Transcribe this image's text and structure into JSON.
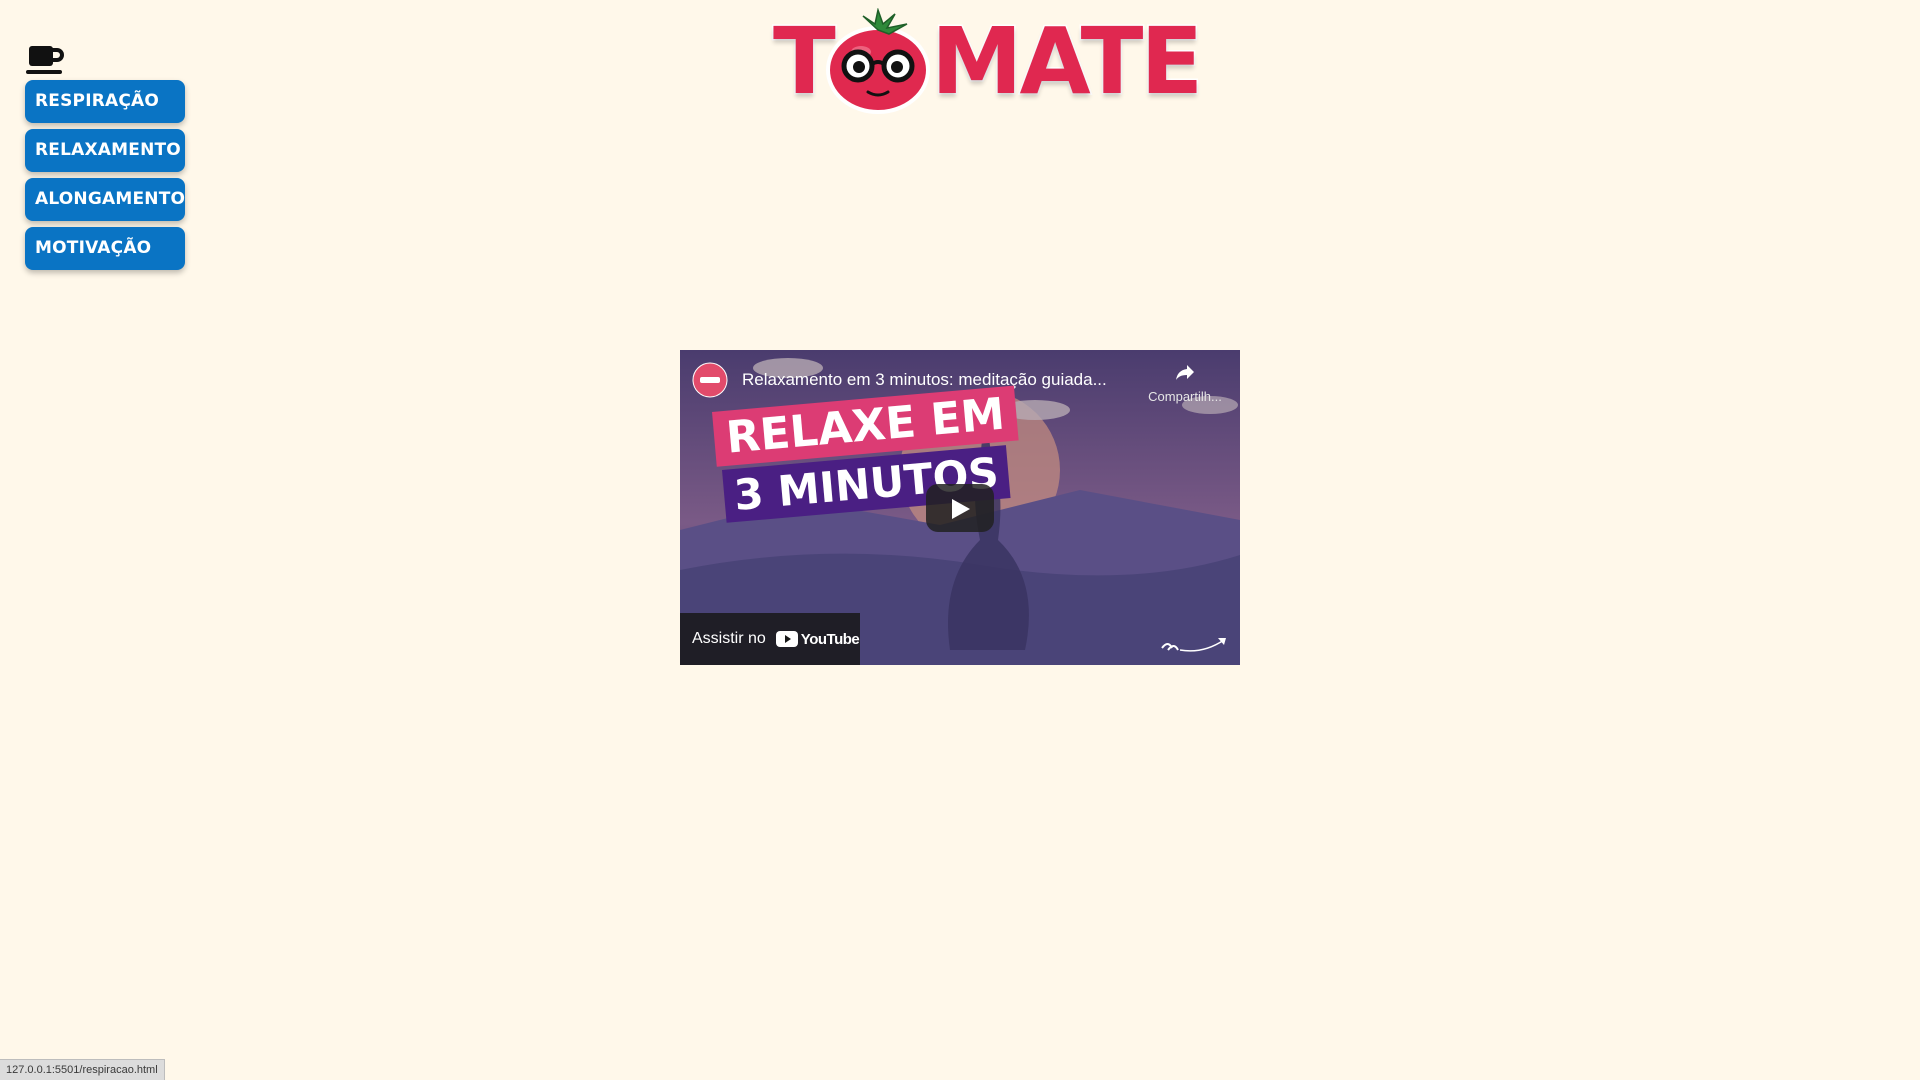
{
  "sidebar": {
    "icon": "coffee-cup-icon",
    "items": [
      {
        "label": "RESPIRAÇÃO"
      },
      {
        "label": "RELAXAMENTO"
      },
      {
        "label": "ALONGAMENTO"
      },
      {
        "label": "MOTIVAÇÃO"
      }
    ],
    "button_color": "#0a74c4"
  },
  "logo": {
    "text_prefix": "T",
    "text_suffix": "MATE",
    "mascot": "tomato-with-glasses-icon",
    "color": "#e02850"
  },
  "video": {
    "title": "Relaxamento em 3 minutos: meditação guiada...",
    "share_label": "Compartilh...",
    "thumbnail_line1": "RELAXE EM",
    "thumbnail_line2": "3 MINUTOS",
    "watch_label": "Assistir no",
    "platform": "YouTube"
  },
  "status_bar": {
    "url": "127.0.0.1:5501/respiracao.html"
  },
  "colors": {
    "background": "#fff8ea"
  }
}
